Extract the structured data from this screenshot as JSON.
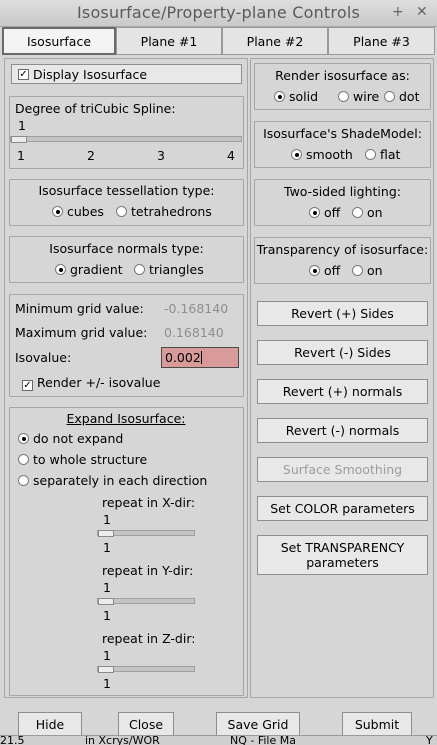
{
  "window": {
    "title": "Isosurface/Property-plane Controls",
    "plus_glyph": "+",
    "close_glyph": "✕"
  },
  "tabs": [
    "Isosurface",
    "Plane #1",
    "Plane #2",
    "Plane #3"
  ],
  "left": {
    "display_isosurface": {
      "label": "Display Isosurface",
      "checked": true
    },
    "spline": {
      "title": "Degree of triCubic Spline:",
      "value": "1",
      "ticks": [
        "1",
        "2",
        "3",
        "4"
      ]
    },
    "tessellation": {
      "title": "Isosurface tessellation type:",
      "options": [
        "cubes",
        "tetrahedrons"
      ],
      "selected": "cubes"
    },
    "normals": {
      "title": "Isosurface normals type:",
      "options": [
        "gradient",
        "triangles"
      ],
      "selected": "gradient"
    },
    "grid": {
      "min_label": "Minimum grid value:",
      "min_value": "-0.168140",
      "max_label": "Maximum grid value:",
      "max_value": "0.168140",
      "iso_label": "Isovalue:",
      "iso_value": "0.002",
      "render_pm_label": "Render +/- isovalue",
      "render_pm_checked": true
    },
    "expand": {
      "title": "Expand Isosurface:",
      "options": [
        "do not expand",
        "to whole structure",
        "separately in each direction"
      ],
      "selected": "do not expand",
      "repeats": [
        {
          "label": "repeat in X-dir:",
          "value": "1",
          "min": "1"
        },
        {
          "label": "repeat in Y-dir:",
          "value": "1",
          "min": "1"
        },
        {
          "label": "repeat in Z-dir:",
          "value": "1",
          "min": "1"
        }
      ]
    }
  },
  "right": {
    "render_as": {
      "title": "Render isosurface as:",
      "options": [
        "solid",
        "wire",
        "dot"
      ],
      "selected": "solid"
    },
    "shade_model": {
      "title": "Isosurface's ShadeModel:",
      "options": [
        "smooth",
        "flat"
      ],
      "selected": "smooth"
    },
    "two_sided": {
      "title": "Two-sided lighting:",
      "options": [
        "off",
        "on"
      ],
      "selected": "off"
    },
    "transparency": {
      "title": "Transparency of isosurface:",
      "options": [
        "off",
        "on"
      ],
      "selected": "off"
    },
    "buttons": {
      "revert_plus_sides": "Revert (+) Sides",
      "revert_minus_sides": "Revert (-) Sides",
      "revert_plus_normals": "Revert (+) normals",
      "revert_minus_normals": "Revert (-) normals",
      "surface_smoothing": "Surface Smoothing",
      "set_color": "Set COLOR parameters",
      "set_transparency_line1": "Set TRANSPARENCY",
      "set_transparency_line2": "parameters"
    }
  },
  "bottom": {
    "hide": "Hide",
    "close": "Close",
    "save_grid": "Save Grid",
    "submit": "Submit"
  },
  "taskbar": {
    "item1": "21.5",
    "item2": "in Xcrys/WOR",
    "item3": "NQ - File Ma",
    "item4": "Y"
  },
  "colors": {
    "isovalue_bg": "#d99a9a",
    "window_bg": "#d6d6d6"
  }
}
